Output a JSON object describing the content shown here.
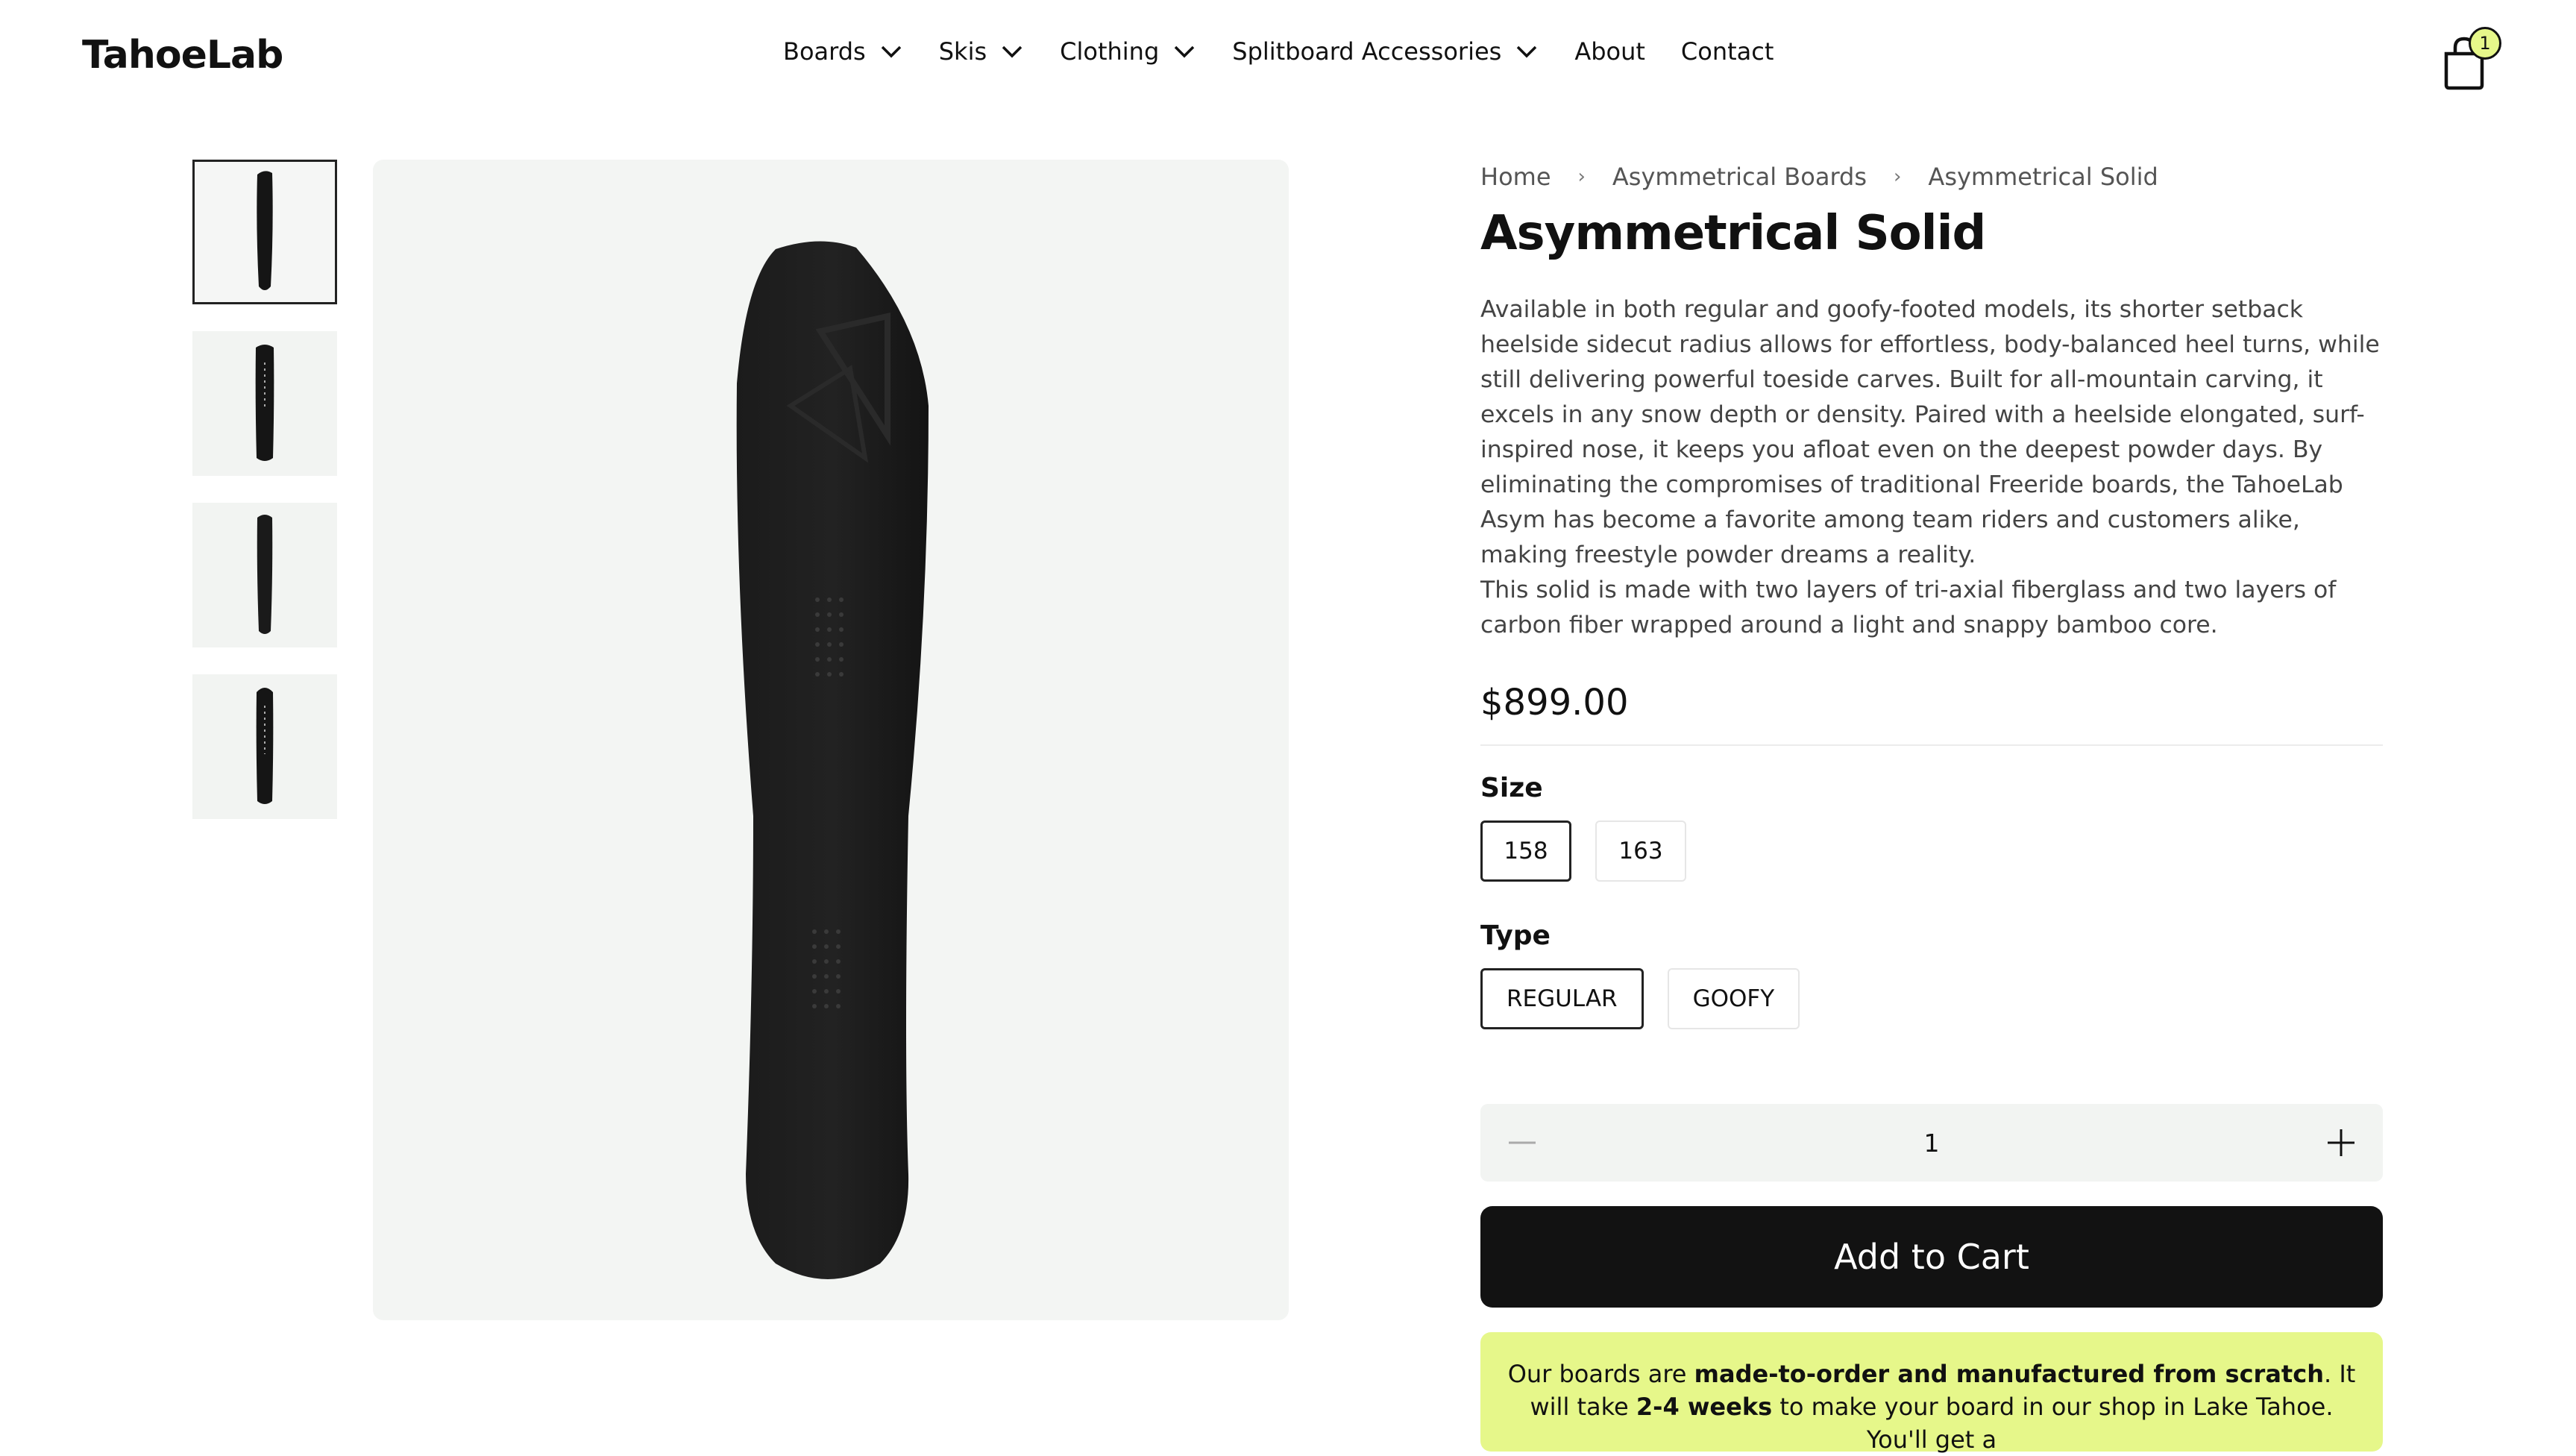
{
  "header": {
    "logo": "TahoeLab",
    "nav": [
      {
        "label": "Boards",
        "has_dropdown": true
      },
      {
        "label": "Skis",
        "has_dropdown": true
      },
      {
        "label": "Clothing",
        "has_dropdown": true
      },
      {
        "label": "Splitboard Accessories",
        "has_dropdown": true
      },
      {
        "label": "About",
        "has_dropdown": false
      },
      {
        "label": "Contact",
        "has_dropdown": false
      }
    ],
    "cart_count": "1",
    "cart_icon": "shopping-bag-icon"
  },
  "gallery": {
    "thumbnails": [
      {
        "name": "thumbnail-1",
        "selected": true
      },
      {
        "name": "thumbnail-2",
        "selected": false
      },
      {
        "name": "thumbnail-3",
        "selected": false
      },
      {
        "name": "thumbnail-4",
        "selected": false
      }
    ]
  },
  "breadcrumb": [
    "Home",
    "Asymmetrical Boards",
    "Asymmetrical Solid"
  ],
  "product": {
    "title": "Asymmetrical Solid",
    "description_1": "Available in both regular and goofy-footed models, its shorter setback heelside sidecut radius allows for effortless, body-balanced heel turns, while still delivering powerful toeside carves. Built for all-mountain carving, it excels in any snow depth or density. Paired with a heelside elongated, surf-inspired nose, it keeps you afloat even on the deepest powder days. By eliminating the compromises of traditional Freeride boards, the TahoeLab Asym has become a favorite among team riders and customers alike, making freestyle powder dreams a reality.",
    "description_2": "This solid is made with two layers of tri-axial fiberglass and two layers of carbon fiber wrapped around a light and snappy bamboo core.",
    "price": "$899.00"
  },
  "options": {
    "size_label": "Size",
    "sizes": [
      "158",
      "163"
    ],
    "selected_size": "158",
    "type_label": "Type",
    "types": [
      "REGULAR",
      "GOOFY"
    ],
    "selected_type": "REGULAR"
  },
  "quantity": {
    "value": "1",
    "decrement_icon": "minus-icon",
    "increment_icon": "plus-icon"
  },
  "add_to_cart": "Add to Cart",
  "notice": {
    "t1": "Our boards are ",
    "b1": "made-to-order and manufactured from scratch",
    "t2": ". It will take ",
    "b2": "2-4 weeks",
    "t3": " to make your board in our shop in Lake Tahoe. You'll get a"
  },
  "colors": {
    "accent": "#e6f78a",
    "button": "#121212",
    "image_bg": "#f3f5f3"
  }
}
